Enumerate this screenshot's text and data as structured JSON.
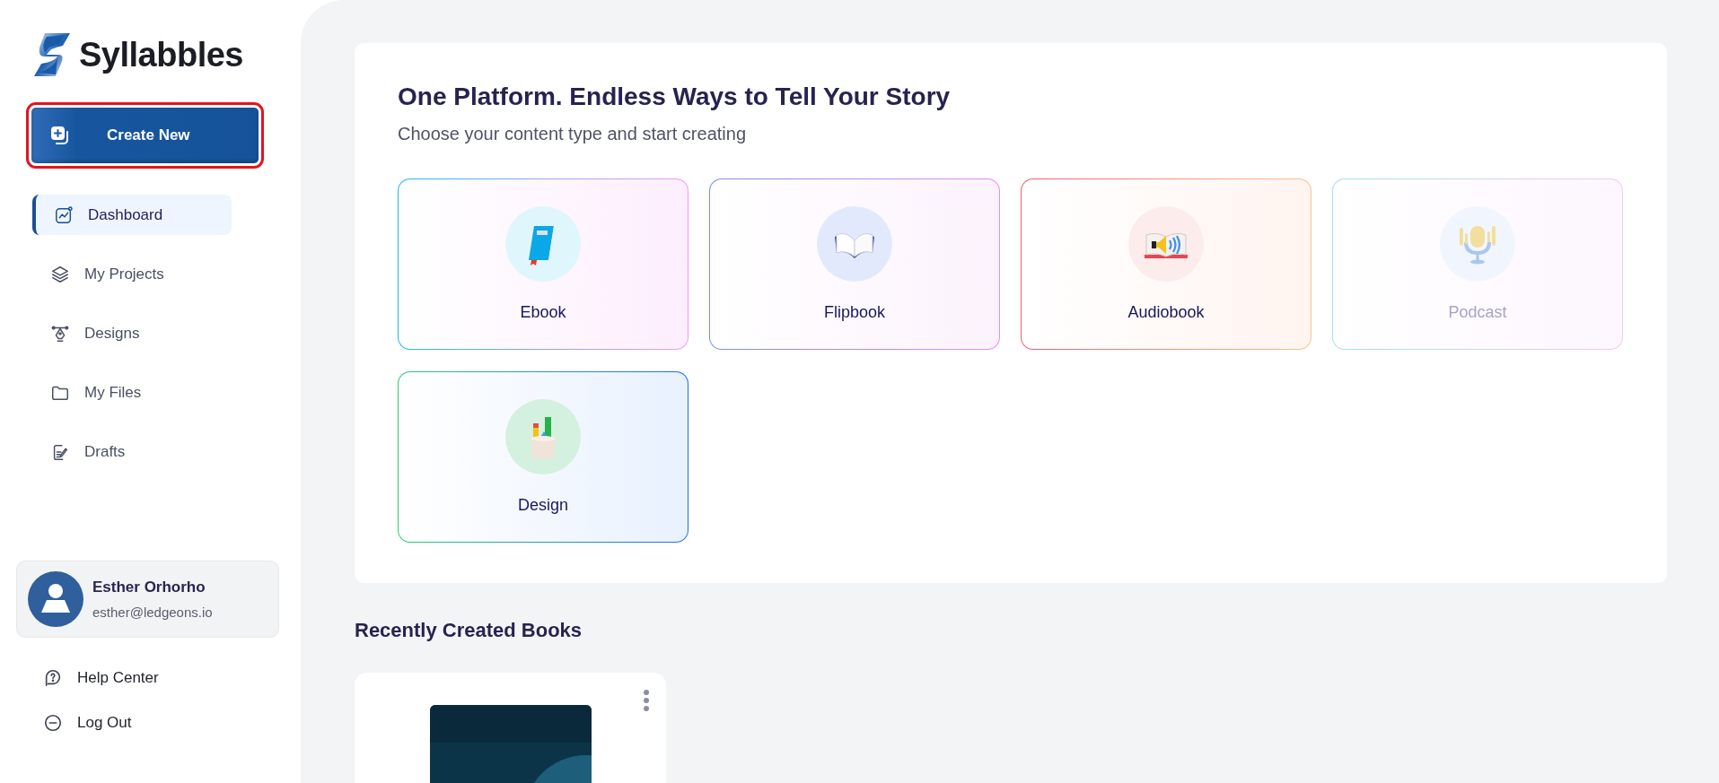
{
  "brand": {
    "name": "Syllabbles"
  },
  "create_button": {
    "label": "Create New",
    "highlighted": true
  },
  "nav": [
    {
      "label": "Dashboard",
      "kind": "dashboard",
      "selected": true
    },
    {
      "label": "My Projects",
      "kind": "projects",
      "selected": false
    },
    {
      "label": "Designs",
      "kind": "designs",
      "selected": false
    },
    {
      "label": "My Files",
      "kind": "files",
      "selected": false
    },
    {
      "label": "Drafts",
      "kind": "drafts",
      "selected": false
    }
  ],
  "profile": {
    "name": "Esther Orhorho",
    "email": "esther@ledgeons.io"
  },
  "footer_links": [
    {
      "label": "Help Center",
      "kind": "help"
    },
    {
      "label": "Log Out",
      "kind": "logout"
    }
  ],
  "hero": {
    "title": "One Platform. Endless Ways to Tell Your Story",
    "subtitle": "Choose your content type and start creating"
  },
  "content_types": [
    {
      "label": "Ebook",
      "kind": "ebook",
      "disabled": false
    },
    {
      "label": "Flipbook",
      "kind": "flipbook",
      "disabled": false
    },
    {
      "label": "Audiobook",
      "kind": "audiobook",
      "disabled": false
    },
    {
      "label": "Podcast",
      "kind": "podcast",
      "disabled": true
    },
    {
      "label": "Design",
      "kind": "design",
      "disabled": false
    }
  ],
  "recent": {
    "title": "Recently Created Books"
  }
}
